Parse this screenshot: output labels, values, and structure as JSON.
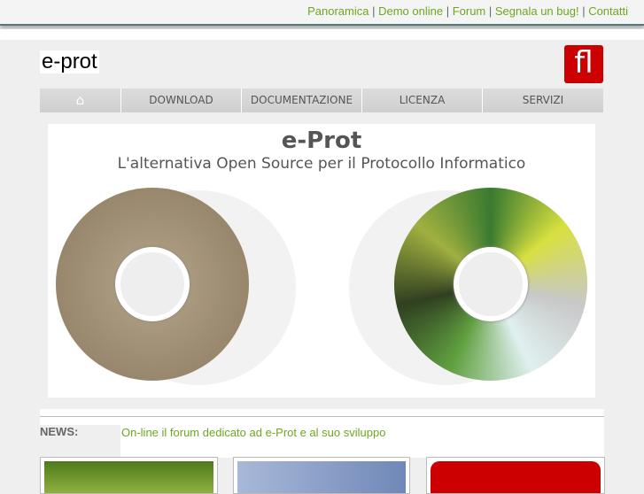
{
  "top_links": [
    "Panoramica",
    "Demo online",
    "Forum",
    "Segnala un bug!",
    "Contatti"
  ],
  "logo": "e-prot",
  "partner_logo": "fl",
  "nav": {
    "home_icon": "home-icon",
    "items": [
      "DOWNLOAD",
      "DOCUMENTAZIONE",
      "LICENZA",
      "SERVIZI"
    ]
  },
  "banner": {
    "title": "e-Prot",
    "subtitle": "L'alternativa Open Source per il Protocollo Informatico"
  },
  "news": {
    "label": "NEWS:",
    "text": "On-line il forum dedicato ad e-Prot e al suo sviluppo"
  }
}
